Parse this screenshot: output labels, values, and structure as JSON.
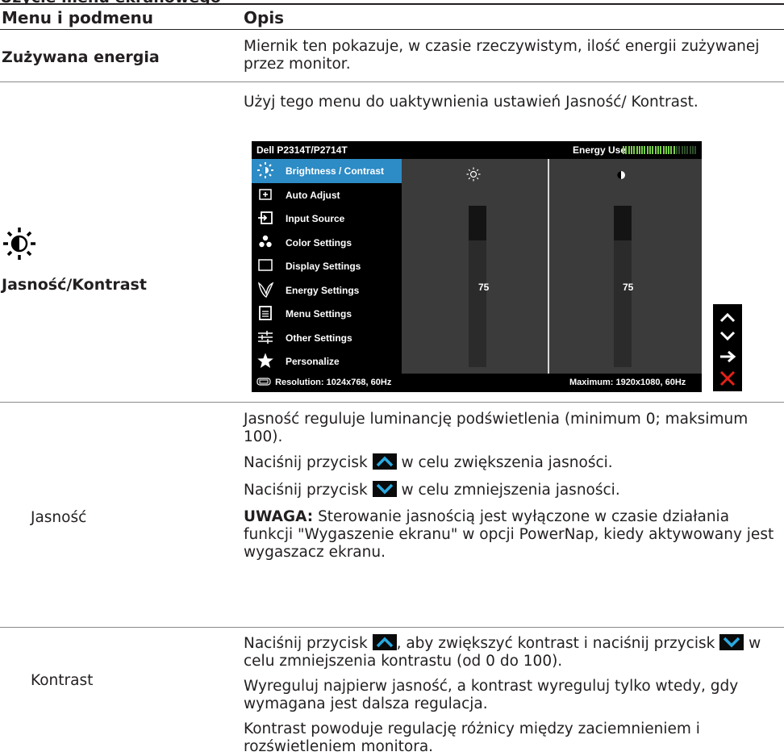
{
  "header": {
    "col1": "Menu i podmenu",
    "col2": "Opis"
  },
  "rows": {
    "energy": {
      "label": "Zużywana energia",
      "desc": "Miernik ten pokazuje, w czasie rzeczywistym, ilość energii zużywanej przez monitor."
    },
    "brightness_contrast": {
      "label": "Jasność/Kontrast",
      "icon": "sun-icon",
      "desc": "Użyj tego menu do uaktywnienia ustawień Jasność/ Kontrast."
    },
    "brightness": {
      "label": "Jasność",
      "p1": "Jasność reguluje luminancję podświetlenia (minimum 0; maksimum 100).",
      "p2_pre": "Naciśnij przycisk",
      "p2_post": "w celu zwiększenia jasności.",
      "p3_pre": "Naciśnij przycisk",
      "p3_post": "w celu zmniejszenia jasności.",
      "note_label": "UWAGA:",
      "note_text": "Sterowanie jasnością jest wyłączone w czasie działania funkcji \"Wygaszenie ekranu\" w opcji PowerNap, kiedy aktywowany jest wygaszacz ekranu."
    },
    "contrast": {
      "label": "Kontrast",
      "p1_a": "Naciśnij przycisk",
      "p1_b": ", aby zwiększyć kontrast i naciśnij przycisk",
      "p1_c": "w celu zmniejszenia kontrastu (od 0 do 100).",
      "p2": "Wyreguluj najpierw jasność, a kontrast wyreguluj tylko wtedy, gdy wymagana jest dalsza regulacja.",
      "p3": "Kontrast powoduje regulację różnicy między zaciemnieniem i rozświetleniem monitora."
    }
  },
  "osd": {
    "model": "Dell P2314T/P2714T",
    "energy_label": "Energy Use",
    "energy_level": 0.72,
    "menu": [
      {
        "label": "Brightness / Contrast",
        "icon": "sun-icon",
        "selected": true
      },
      {
        "label": "Auto Adjust",
        "icon": "auto-adjust-icon"
      },
      {
        "label": "Input Source",
        "icon": "input-source-icon"
      },
      {
        "label": "Color Settings",
        "icon": "color-dots-icon"
      },
      {
        "label": "Display Settings",
        "icon": "display-icon"
      },
      {
        "label": "Energy Settings",
        "icon": "leaf-icon"
      },
      {
        "label": "Menu Settings",
        "icon": "menu-list-icon"
      },
      {
        "label": "Other Settings",
        "icon": "sliders-icon"
      },
      {
        "label": "Personalize",
        "icon": "star-icon"
      }
    ],
    "brightness_value": "75",
    "contrast_value": "75",
    "resolution": "Resolution: 1024x768, 60Hz",
    "maximum": "Maximum: 1920x1080, 60Hz",
    "buttons": [
      "up-arrow-icon",
      "down-arrow-icon",
      "right-arrow-icon",
      "close-icon"
    ]
  }
}
